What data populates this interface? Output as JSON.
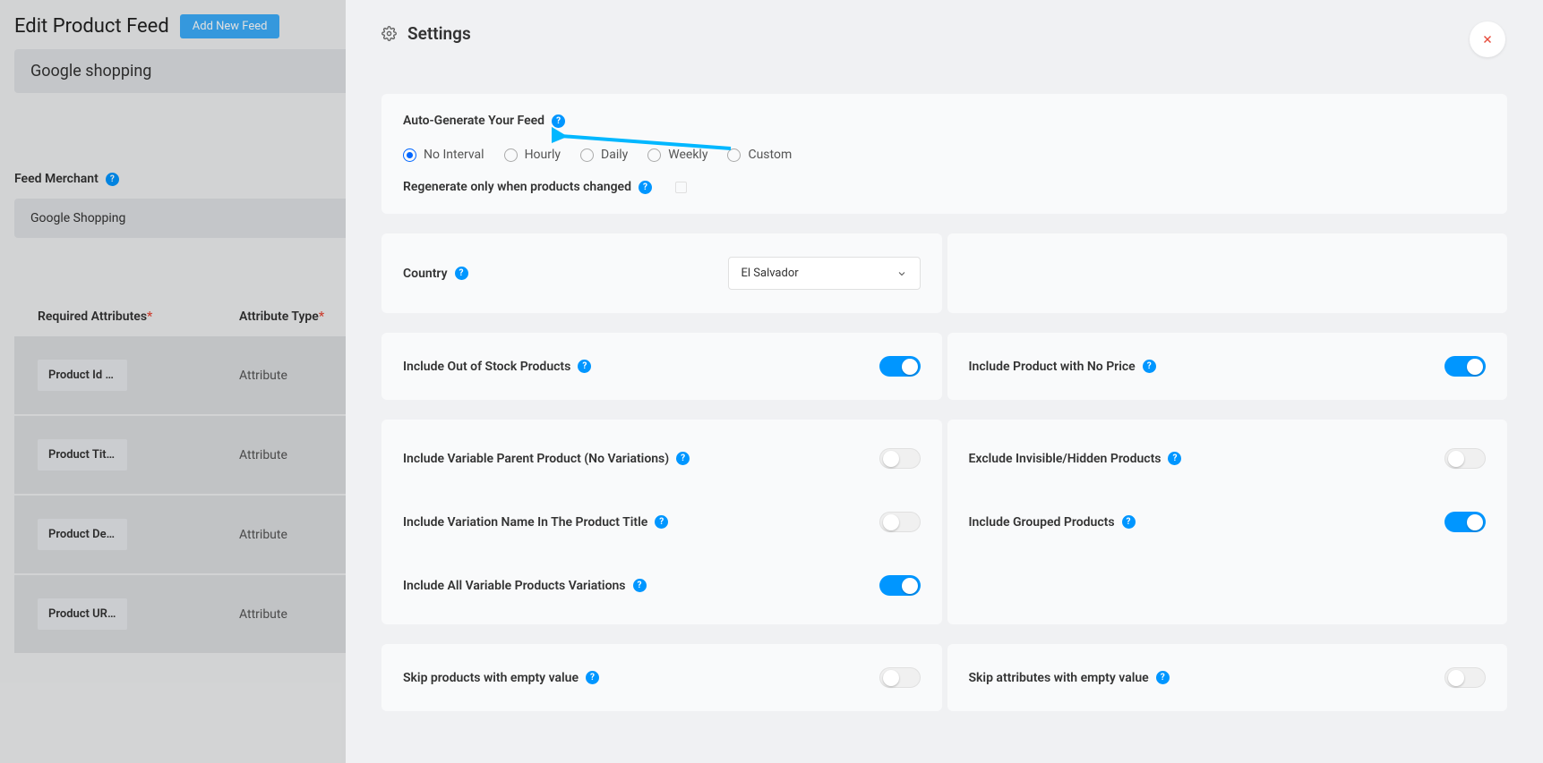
{
  "header": {
    "title": "Edit Product Feed",
    "add_button": "Add New Feed"
  },
  "feed_name": "Google shopping",
  "merchant": {
    "label": "Feed Merchant",
    "value": "Google Shopping"
  },
  "attributes": {
    "header_required": "Required Attributes",
    "header_type": "Attribute Type",
    "rows": [
      {
        "name": "Product Id [id]",
        "type": "Attribute"
      },
      {
        "name": "Product Title …",
        "type": "Attribute"
      },
      {
        "name": "Product Desc…",
        "type": "Attribute"
      },
      {
        "name": "Product URL …",
        "type": "Attribute"
      }
    ]
  },
  "settings": {
    "panel_title": "Settings",
    "auto_generate": {
      "label": "Auto-Generate Your Feed",
      "options": [
        "No Interval",
        "Hourly",
        "Daily",
        "Weekly",
        "Custom"
      ],
      "selected": "No Interval"
    },
    "regenerate_label": "Regenerate only when products changed",
    "country": {
      "label": "Country",
      "value": "El Salvador"
    },
    "toggles": {
      "out_of_stock": {
        "label": "Include Out of Stock Products",
        "on": true
      },
      "no_price": {
        "label": "Include Product with No Price",
        "on": true
      },
      "variable_parent": {
        "label": "Include Variable Parent Product (No Variations)",
        "on": false
      },
      "exclude_invisible": {
        "label": "Exclude Invisible/Hidden Products",
        "on": false
      },
      "variation_name": {
        "label": "Include Variation Name In The Product Title",
        "on": false
      },
      "grouped": {
        "label": "Include Grouped Products",
        "on": true
      },
      "all_variations": {
        "label": "Include All Variable Products Variations",
        "on": true
      },
      "skip_products_empty": {
        "label": "Skip products with empty value",
        "on": false
      },
      "skip_attributes_empty": {
        "label": "Skip attributes with empty value",
        "on": false
      }
    }
  }
}
